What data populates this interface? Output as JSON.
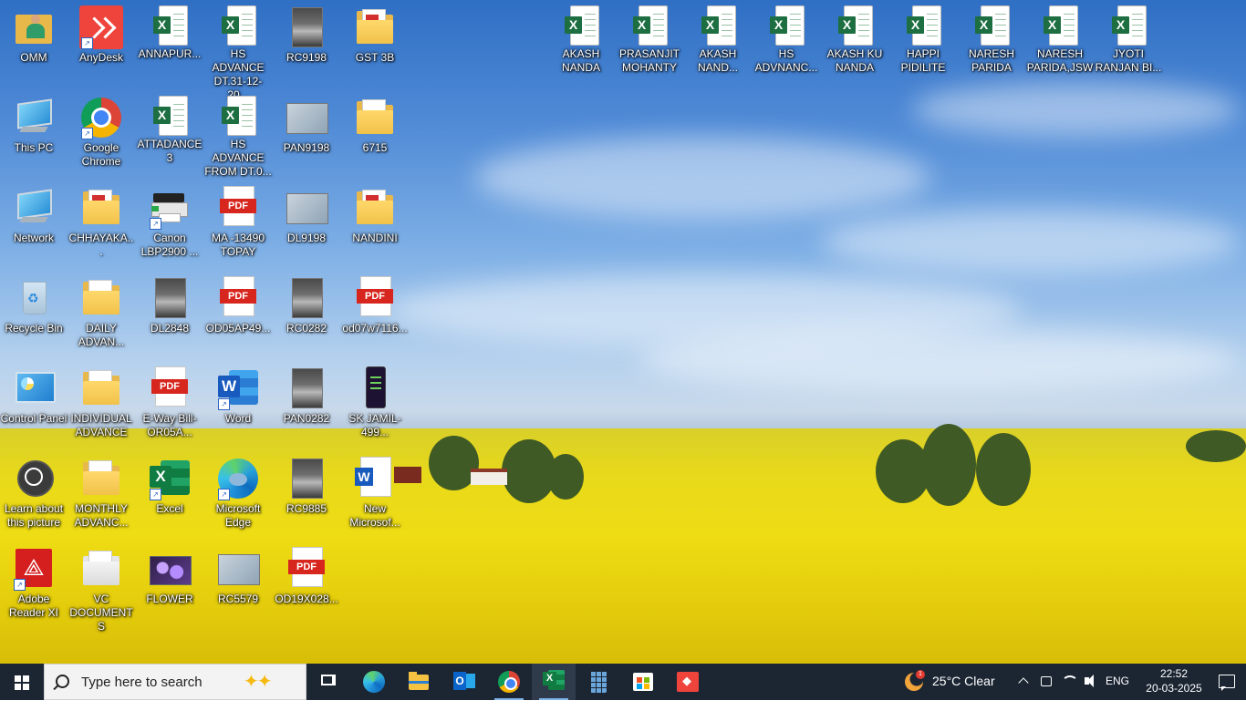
{
  "desktop": {
    "icons": [
      {
        "label": "OMM",
        "type": "user-folder"
      },
      {
        "label": "AnyDesk",
        "type": "anydesk"
      },
      {
        "label": "ANNAPUR...",
        "type": "excel-file"
      },
      {
        "label": "HS ADVANCE DT.31-12-20...",
        "type": "excel-file"
      },
      {
        "label": "RC9198",
        "type": "photo"
      },
      {
        "label": "GST 3B",
        "type": "pdf-folder"
      },
      {
        "label": "This PC",
        "type": "this-pc"
      },
      {
        "label": "Google Chrome",
        "type": "chrome"
      },
      {
        "label": "ATTADANCE 3",
        "type": "excel-file"
      },
      {
        "label": "HS ADVANCE FROM DT.0...",
        "type": "excel-file"
      },
      {
        "label": "PAN9198",
        "type": "scan"
      },
      {
        "label": "6715",
        "type": "folder"
      },
      {
        "label": "Network",
        "type": "network"
      },
      {
        "label": "CHHAYAKA...",
        "type": "pdf-folder"
      },
      {
        "label": "Canon LBP2900 ...",
        "type": "printer"
      },
      {
        "label": "MA -13490 TOPAY",
        "type": "pdf"
      },
      {
        "label": "DL9198",
        "type": "scan"
      },
      {
        "label": "NANDINI",
        "type": "pdf-folder"
      },
      {
        "label": "Recycle Bin",
        "type": "recycle-bin"
      },
      {
        "label": "DAILY ADVAN...",
        "type": "folder"
      },
      {
        "label": "DL2848",
        "type": "photo"
      },
      {
        "label": "OD05AP49...",
        "type": "pdf"
      },
      {
        "label": "RC0282",
        "type": "photo"
      },
      {
        "label": "od07w7116...",
        "type": "pdf"
      },
      {
        "label": "Control Panel",
        "type": "control-panel"
      },
      {
        "label": "INDIVIDUAL ADVANCE",
        "type": "folder"
      },
      {
        "label": "E-Way Bill-OR05A...",
        "type": "pdf"
      },
      {
        "label": "Word",
        "type": "word-app"
      },
      {
        "label": "PAN0282",
        "type": "photo"
      },
      {
        "label": "SK JAMIL-499...",
        "type": "phone"
      },
      {
        "label": "Learn about this picture",
        "type": "learn"
      },
      {
        "label": "MONTHLY ADVANC...",
        "type": "folder"
      },
      {
        "label": "Excel",
        "type": "excel-app"
      },
      {
        "label": "Microsoft Edge",
        "type": "edge"
      },
      {
        "label": "RC9885",
        "type": "photo"
      },
      {
        "label": "New Microsof...",
        "type": "docx"
      },
      {
        "label": "Adobe Reader XI",
        "type": "adobe"
      },
      {
        "label": "VC DOCUMENTS",
        "type": "folder-plain"
      },
      {
        "label": "FLOWER",
        "type": "flower"
      },
      {
        "label": "RC5579",
        "type": "scan"
      },
      {
        "label": "OD19X028...",
        "type": "pdf"
      },
      {
        "label": "AKASH NANDA",
        "type": "excel-file"
      },
      {
        "label": "PRASANJIT MOHANTY",
        "type": "excel-file"
      },
      {
        "label": "AKASH NAND...",
        "type": "excel-file"
      },
      {
        "label": "HS ADVNANC...",
        "type": "excel-file"
      },
      {
        "label": "AKASH KU NANDA",
        "type": "excel-file"
      },
      {
        "label": "HAPPI PIDILITE",
        "type": "excel-file"
      },
      {
        "label": "NARESH PARIDA",
        "type": "excel-file"
      },
      {
        "label": "NARESH PARIDA,JSW",
        "type": "excel-file"
      },
      {
        "label": "JYOTI RANJAN BI...",
        "type": "excel-file"
      }
    ]
  },
  "taskbar": {
    "search_placeholder": "Type here to search",
    "pinned": [
      {
        "name": "task-view"
      },
      {
        "name": "microsoft-edge"
      },
      {
        "name": "file-explorer"
      },
      {
        "name": "outlook"
      },
      {
        "name": "google-chrome"
      },
      {
        "name": "excel"
      },
      {
        "name": "calculator"
      },
      {
        "name": "microsoft-store"
      },
      {
        "name": "anydesk"
      }
    ],
    "weather": {
      "text": "25°C  Clear",
      "badge": "1"
    },
    "language": "ENG",
    "time": "22:52",
    "date": "20-03-2025"
  },
  "colors": {
    "taskbar_bg": "#1c2633",
    "excel_green": "#1d6f42",
    "pdf_red": "#d7261e",
    "anydesk_red": "#ef443b"
  }
}
